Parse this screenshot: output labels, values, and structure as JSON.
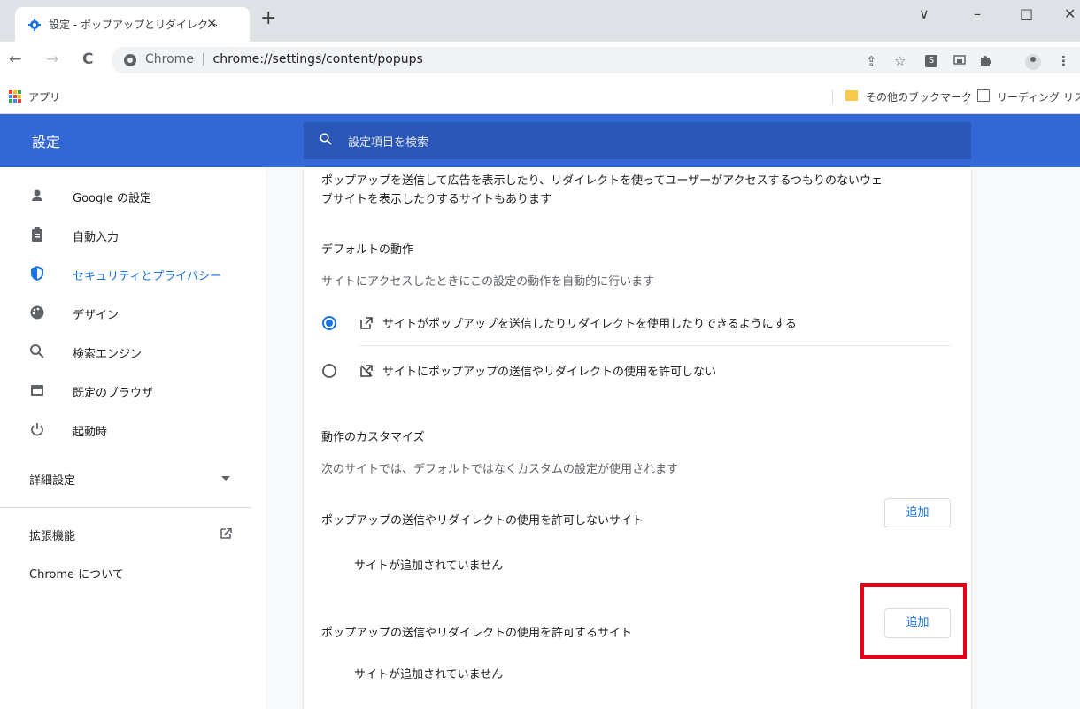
{
  "browser": {
    "tab_title": "設定 - ポップアップとリダイレクト",
    "tab_close": "×",
    "new_tab": "+",
    "window_controls": [
      "∨",
      "–",
      "□",
      "✕"
    ],
    "nav": {
      "back": "←",
      "forward": "→",
      "reload": "C"
    },
    "address": {
      "site_label": "Chrome",
      "separator": "|",
      "url": "chrome://settings/content/popups"
    },
    "toolbar_icons": [
      "share-icon",
      "star-icon",
      "extension-s-icon",
      "cast-icon",
      "puzzle-icon",
      "profile-icon",
      "menu-icon"
    ],
    "star": "☆",
    "share": "⇪",
    "menu": "⋮"
  },
  "bookmarks": {
    "apps_label": "アプリ",
    "other_bookmarks": "その他のブックマーク",
    "reading_list": "リーディング リスト",
    "apps_colors": [
      "#ea4335",
      "#fbbc04",
      "#34a853",
      "#4285f4",
      "#ea4335",
      "#fbbc04",
      "#34a853",
      "#4285f4",
      "#ea4335"
    ]
  },
  "header": {
    "title": "設定",
    "search_placeholder": "設定項目を検索",
    "bg_color": "#3367d6"
  },
  "sidebar": {
    "items": [
      {
        "label": "Google の設定",
        "icon": "person-icon"
      },
      {
        "label": "自動入力",
        "icon": "clipboard-icon"
      },
      {
        "label": "セキュリティとプライバシー",
        "icon": "shield-icon",
        "active": true
      },
      {
        "label": "デザイン",
        "icon": "palette-icon"
      },
      {
        "label": "検索エンジン",
        "icon": "search-icon"
      },
      {
        "label": "既定のブラウザ",
        "icon": "browser-icon"
      },
      {
        "label": "起動時",
        "icon": "power-icon"
      }
    ],
    "advanced": "詳細設定",
    "extensions": "拡張機能",
    "about": "Chrome について"
  },
  "content": {
    "intro_line1": "ポップアップを送信して広告を表示したり、リダイレクトを使ってユーザーがアクセスするつもりのないウェ",
    "intro_line2": "ブサイトを表示したりするサイトもあります",
    "default_heading": "デフォルトの動作",
    "default_desc": "サイトにアクセスしたときにこの設定の動作を自動的に行います",
    "option_allow": "サイトがポップアップを送信したりリダイレクトを使用したりできるようにする",
    "option_block": "サイトにポップアップの送信やリダイレクトの使用を許可しない",
    "selected_option": "allow",
    "custom_heading": "動作のカスタマイズ",
    "custom_desc": "次のサイトでは、デフォルトではなくカスタムの設定が使用されます",
    "block_list_title": "ポップアップの送信やリダイレクトの使用を許可しないサイト",
    "block_list_empty": "サイトが追加されていません",
    "allow_list_title": "ポップアップの送信やリダイレクトの使用を許可するサイト",
    "allow_list_empty": "サイトが追加されていません",
    "add_label": "追加",
    "accent_color": "#1a73e8",
    "highlight_color": "#e6001a"
  }
}
